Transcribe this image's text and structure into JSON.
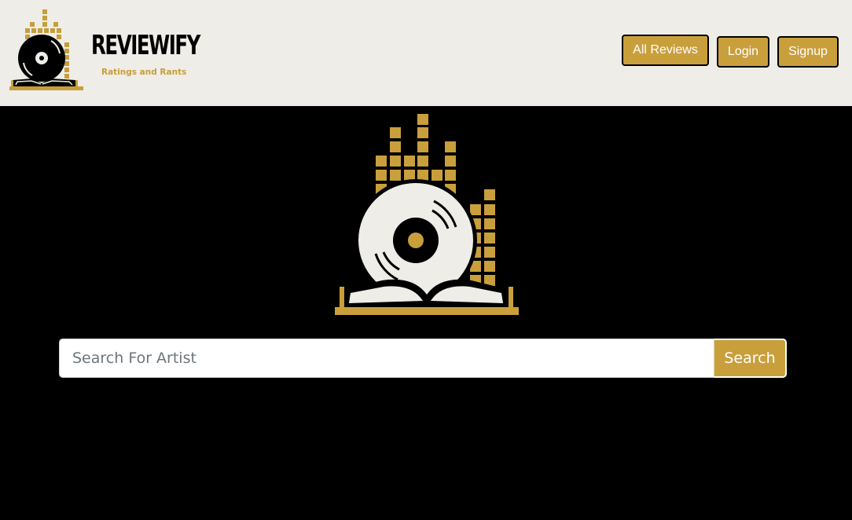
{
  "colors": {
    "accent": "#c99f3c",
    "header_bg": "#efede8",
    "page_bg": "#000000",
    "record_face": "#efede8"
  },
  "brand": {
    "name": "REVIEWIFY",
    "tagline": "Ratings and Rants",
    "logo_icon": "vinyl-record-book-equalizer-icon"
  },
  "nav": {
    "all_reviews": "All Reviews",
    "login": "Login",
    "signup": "Signup"
  },
  "hero": {
    "logo_icon": "vinyl-record-book-equalizer-icon"
  },
  "search": {
    "placeholder": "Search For Artist",
    "value": "",
    "button_label": "Search"
  }
}
